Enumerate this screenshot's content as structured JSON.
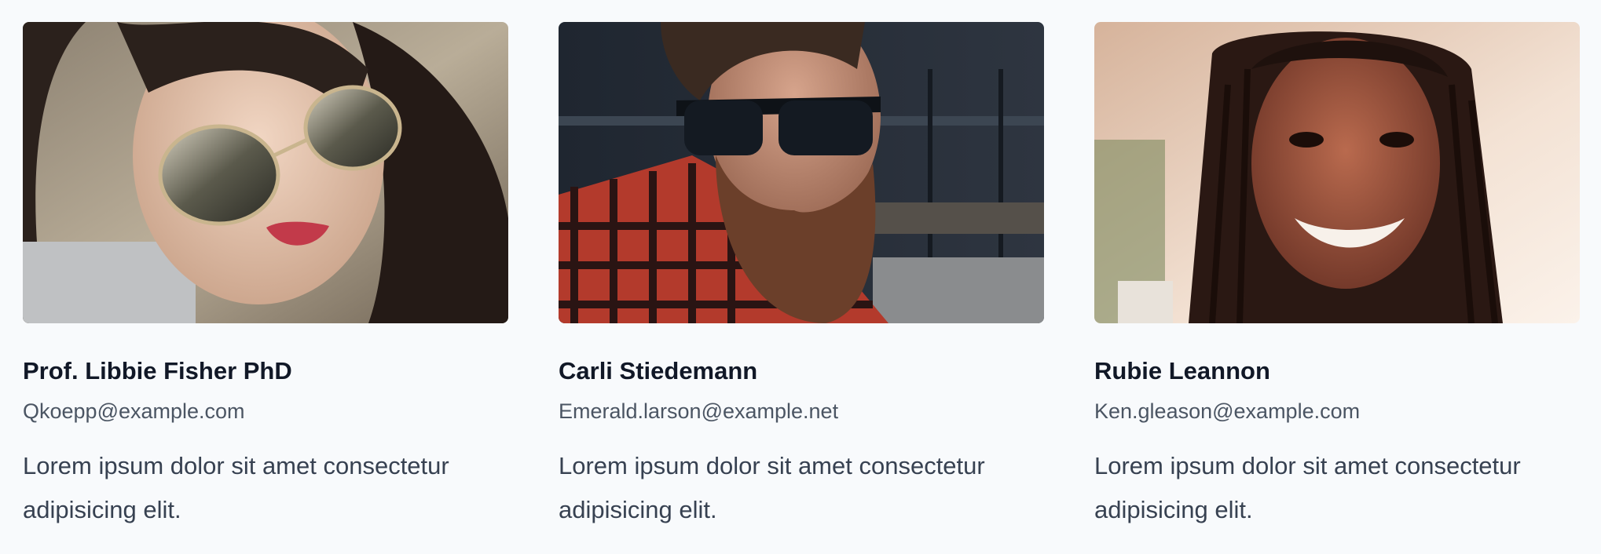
{
  "team": {
    "members": [
      {
        "name": "Prof. Libbie Fisher PhD",
        "email": "Qkoepp@example.com",
        "bio": "Lorem ipsum dolor sit amet consectetur adipisicing elit."
      },
      {
        "name": "Carli Stiedemann",
        "email": "Emerald.larson@example.net",
        "bio": "Lorem ipsum dolor sit amet consectetur adipisicing elit."
      },
      {
        "name": "Rubie Leannon",
        "email": "Ken.gleason@example.com",
        "bio": "Lorem ipsum dolor sit amet consectetur adipisicing elit."
      }
    ]
  },
  "colors": {
    "background": "#f8fafc",
    "name_text": "#111827",
    "email_text": "#4b5563",
    "bio_text": "#374151"
  }
}
